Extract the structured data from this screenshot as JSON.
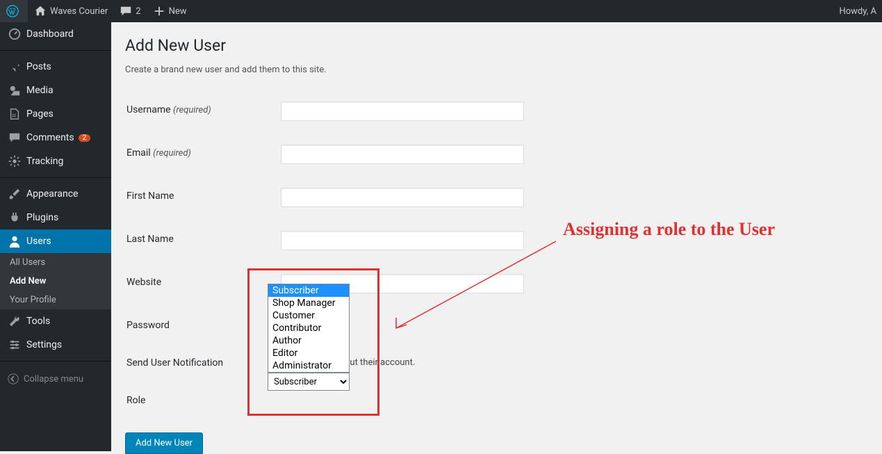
{
  "adminbar": {
    "site_name": "Waves Courier",
    "comments_count": "2",
    "new_label": "New",
    "howdy": "Howdy, A"
  },
  "sidebar": {
    "items": [
      {
        "icon": "dashboard",
        "label": "Dashboard"
      },
      {
        "icon": "pin",
        "label": "Posts"
      },
      {
        "icon": "media",
        "label": "Media"
      },
      {
        "icon": "page",
        "label": "Pages"
      },
      {
        "icon": "comment",
        "label": "Comments",
        "bubble": "2"
      },
      {
        "icon": "gear",
        "label": "Tracking"
      },
      {
        "icon": "brush",
        "label": "Appearance"
      },
      {
        "icon": "plug",
        "label": "Plugins"
      },
      {
        "icon": "user",
        "label": "Users"
      },
      {
        "icon": "wrench",
        "label": "Tools"
      },
      {
        "icon": "sliders",
        "label": "Settings"
      }
    ],
    "users_submenu": [
      "All Users",
      "Add New",
      "Your Profile"
    ],
    "collapse": "Collapse menu"
  },
  "page": {
    "title": "Add New User",
    "description": "Create a brand new user and add them to this site.",
    "labels": {
      "username": "Username",
      "email": "Email",
      "first_name": "First Name",
      "last_name": "Last Name",
      "website": "Website",
      "password": "Password",
      "notification": "Send User Notification",
      "role": "Role",
      "required": "(required)"
    },
    "notification_text": "ser an email about their account.",
    "role_options": [
      "Subscriber",
      "Shop Manager",
      "Customer",
      "Contributor",
      "Author",
      "Editor",
      "Administrator"
    ],
    "role_selected": "Subscriber",
    "submit": "Add New User"
  },
  "annotation": {
    "text": "Assigning a role to the User"
  }
}
